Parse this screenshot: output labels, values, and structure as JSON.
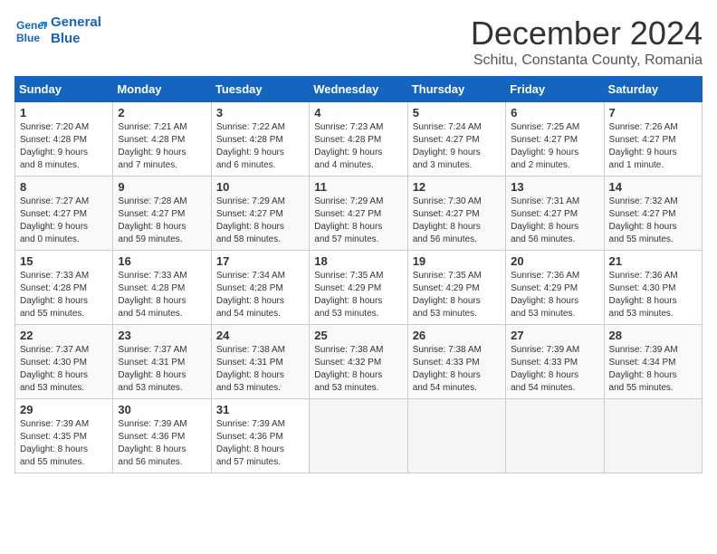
{
  "header": {
    "logo_line1": "General",
    "logo_line2": "Blue",
    "month": "December 2024",
    "location": "Schitu, Constanta County, Romania"
  },
  "days_of_week": [
    "Sunday",
    "Monday",
    "Tuesday",
    "Wednesday",
    "Thursday",
    "Friday",
    "Saturday"
  ],
  "weeks": [
    [
      {
        "day": 1,
        "lines": [
          "Sunrise: 7:20 AM",
          "Sunset: 4:28 PM",
          "Daylight: 9 hours",
          "and 8 minutes."
        ]
      },
      {
        "day": 2,
        "lines": [
          "Sunrise: 7:21 AM",
          "Sunset: 4:28 PM",
          "Daylight: 9 hours",
          "and 7 minutes."
        ]
      },
      {
        "day": 3,
        "lines": [
          "Sunrise: 7:22 AM",
          "Sunset: 4:28 PM",
          "Daylight: 9 hours",
          "and 6 minutes."
        ]
      },
      {
        "day": 4,
        "lines": [
          "Sunrise: 7:23 AM",
          "Sunset: 4:28 PM",
          "Daylight: 9 hours",
          "and 4 minutes."
        ]
      },
      {
        "day": 5,
        "lines": [
          "Sunrise: 7:24 AM",
          "Sunset: 4:27 PM",
          "Daylight: 9 hours",
          "and 3 minutes."
        ]
      },
      {
        "day": 6,
        "lines": [
          "Sunrise: 7:25 AM",
          "Sunset: 4:27 PM",
          "Daylight: 9 hours",
          "and 2 minutes."
        ]
      },
      {
        "day": 7,
        "lines": [
          "Sunrise: 7:26 AM",
          "Sunset: 4:27 PM",
          "Daylight: 9 hours",
          "and 1 minute."
        ]
      }
    ],
    [
      {
        "day": 8,
        "lines": [
          "Sunrise: 7:27 AM",
          "Sunset: 4:27 PM",
          "Daylight: 9 hours",
          "and 0 minutes."
        ]
      },
      {
        "day": 9,
        "lines": [
          "Sunrise: 7:28 AM",
          "Sunset: 4:27 PM",
          "Daylight: 8 hours",
          "and 59 minutes."
        ]
      },
      {
        "day": 10,
        "lines": [
          "Sunrise: 7:29 AM",
          "Sunset: 4:27 PM",
          "Daylight: 8 hours",
          "and 58 minutes."
        ]
      },
      {
        "day": 11,
        "lines": [
          "Sunrise: 7:29 AM",
          "Sunset: 4:27 PM",
          "Daylight: 8 hours",
          "and 57 minutes."
        ]
      },
      {
        "day": 12,
        "lines": [
          "Sunrise: 7:30 AM",
          "Sunset: 4:27 PM",
          "Daylight: 8 hours",
          "and 56 minutes."
        ]
      },
      {
        "day": 13,
        "lines": [
          "Sunrise: 7:31 AM",
          "Sunset: 4:27 PM",
          "Daylight: 8 hours",
          "and 56 minutes."
        ]
      },
      {
        "day": 14,
        "lines": [
          "Sunrise: 7:32 AM",
          "Sunset: 4:27 PM",
          "Daylight: 8 hours",
          "and 55 minutes."
        ]
      }
    ],
    [
      {
        "day": 15,
        "lines": [
          "Sunrise: 7:33 AM",
          "Sunset: 4:28 PM",
          "Daylight: 8 hours",
          "and 55 minutes."
        ]
      },
      {
        "day": 16,
        "lines": [
          "Sunrise: 7:33 AM",
          "Sunset: 4:28 PM",
          "Daylight: 8 hours",
          "and 54 minutes."
        ]
      },
      {
        "day": 17,
        "lines": [
          "Sunrise: 7:34 AM",
          "Sunset: 4:28 PM",
          "Daylight: 8 hours",
          "and 54 minutes."
        ]
      },
      {
        "day": 18,
        "lines": [
          "Sunrise: 7:35 AM",
          "Sunset: 4:29 PM",
          "Daylight: 8 hours",
          "and 53 minutes."
        ]
      },
      {
        "day": 19,
        "lines": [
          "Sunrise: 7:35 AM",
          "Sunset: 4:29 PM",
          "Daylight: 8 hours",
          "and 53 minutes."
        ]
      },
      {
        "day": 20,
        "lines": [
          "Sunrise: 7:36 AM",
          "Sunset: 4:29 PM",
          "Daylight: 8 hours",
          "and 53 minutes."
        ]
      },
      {
        "day": 21,
        "lines": [
          "Sunrise: 7:36 AM",
          "Sunset: 4:30 PM",
          "Daylight: 8 hours",
          "and 53 minutes."
        ]
      }
    ],
    [
      {
        "day": 22,
        "lines": [
          "Sunrise: 7:37 AM",
          "Sunset: 4:30 PM",
          "Daylight: 8 hours",
          "and 53 minutes."
        ]
      },
      {
        "day": 23,
        "lines": [
          "Sunrise: 7:37 AM",
          "Sunset: 4:31 PM",
          "Daylight: 8 hours",
          "and 53 minutes."
        ]
      },
      {
        "day": 24,
        "lines": [
          "Sunrise: 7:38 AM",
          "Sunset: 4:31 PM",
          "Daylight: 8 hours",
          "and 53 minutes."
        ]
      },
      {
        "day": 25,
        "lines": [
          "Sunrise: 7:38 AM",
          "Sunset: 4:32 PM",
          "Daylight: 8 hours",
          "and 53 minutes."
        ]
      },
      {
        "day": 26,
        "lines": [
          "Sunrise: 7:38 AM",
          "Sunset: 4:33 PM",
          "Daylight: 8 hours",
          "and 54 minutes."
        ]
      },
      {
        "day": 27,
        "lines": [
          "Sunrise: 7:39 AM",
          "Sunset: 4:33 PM",
          "Daylight: 8 hours",
          "and 54 minutes."
        ]
      },
      {
        "day": 28,
        "lines": [
          "Sunrise: 7:39 AM",
          "Sunset: 4:34 PM",
          "Daylight: 8 hours",
          "and 55 minutes."
        ]
      }
    ],
    [
      {
        "day": 29,
        "lines": [
          "Sunrise: 7:39 AM",
          "Sunset: 4:35 PM",
          "Daylight: 8 hours",
          "and 55 minutes."
        ]
      },
      {
        "day": 30,
        "lines": [
          "Sunrise: 7:39 AM",
          "Sunset: 4:36 PM",
          "Daylight: 8 hours",
          "and 56 minutes."
        ]
      },
      {
        "day": 31,
        "lines": [
          "Sunrise: 7:39 AM",
          "Sunset: 4:36 PM",
          "Daylight: 8 hours",
          "and 57 minutes."
        ]
      },
      null,
      null,
      null,
      null
    ]
  ]
}
